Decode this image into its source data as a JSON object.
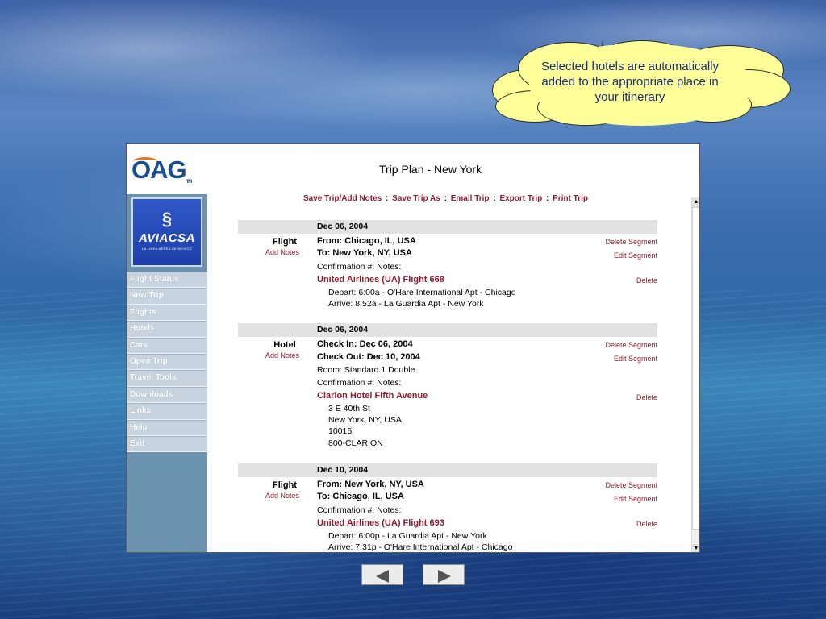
{
  "callout": {
    "text": "Selected hotels are automatically added to the appropriate place in your itinerary",
    "fill_color": "#ffff99"
  },
  "app": {
    "logo_text": "OAG",
    "logo_tm": "TM",
    "title": "Trip Plan - New York",
    "airline_logo": {
      "name": "AVIACSA",
      "tagline": "LA LINEA AEREA DE MEXICO"
    },
    "toolbar": {
      "save_trip_add_notes": "Save Trip/Add Notes",
      "save_trip_as": "Save Trip As",
      "email_trip": "Email Trip",
      "export_trip": "Export Trip",
      "print_trip": "Print Trip",
      "separator": ":"
    },
    "sidebar": {
      "items": [
        {
          "label": "Flight Status"
        },
        {
          "label": "New Trip"
        },
        {
          "label": "Flights"
        },
        {
          "label": "Hotels"
        },
        {
          "label": "Cars"
        },
        {
          "label": "Open Trip"
        },
        {
          "label": "Travel Tools"
        },
        {
          "label": "Downloads"
        },
        {
          "label": "Links"
        },
        {
          "label": "Help"
        },
        {
          "label": "Exit"
        }
      ]
    },
    "segments": [
      {
        "date": "Dec 06, 2004",
        "type": "Flight",
        "add_notes": "Add Notes",
        "from": "From: Chicago, IL, USA",
        "to": "To: New York, NY, USA",
        "confirmation": "Confirmation #:  Notes:",
        "title": "United Airlines (UA) Flight 668",
        "detail_1": "Depart: 6:00a - O'Hare International Apt - Chicago",
        "detail_2": "Arrive: 8:52a  - La Guardia Apt - New York",
        "delete_segment": "Delete Segment",
        "edit_segment": "Edit Segment",
        "delete": "Delete"
      },
      {
        "date": "Dec 06, 2004",
        "type": "Hotel",
        "add_notes": "Add Notes",
        "check_in": "Check In:  Dec 06, 2004",
        "check_out": "Check Out:  Dec 10, 2004",
        "room": "Room: Standard 1 Double",
        "confirmation": "Confirmation #:  Notes:",
        "title": "Clarion Hotel Fifth Avenue",
        "address_1": "3 E 40th St",
        "address_2": "New York, NY, USA",
        "address_3": "10016",
        "address_4": "800-CLARION",
        "delete_segment": "Delete Segment",
        "edit_segment": "Edit Segment",
        "delete": "Delete"
      },
      {
        "date": "Dec 10, 2004",
        "type": "Flight",
        "add_notes": "Add Notes",
        "from": "From: New York, NY, USA",
        "to": "To: Chicago, IL, USA",
        "confirmation": "Confirmation #:  Notes:",
        "title": "United Airlines (UA) Flight 693",
        "detail_1": "Depart: 6:00p - La Guardia Apt - New York",
        "detail_2": "Arrive: 7:31p  - O'Hare International Apt - Chicago",
        "delete_segment": "Delete Segment",
        "edit_segment": "Edit Segment",
        "delete": "Delete"
      }
    ]
  },
  "slide_nav": {
    "prev_icon": "arrow-left-icon",
    "next_icon": "arrow-right-icon"
  },
  "colors": {
    "accent_maroon": "#8b1e2f",
    "sidebar": "#6b93b0",
    "logo_blue": "#1a4f8f",
    "logo_orange": "#e87722"
  }
}
